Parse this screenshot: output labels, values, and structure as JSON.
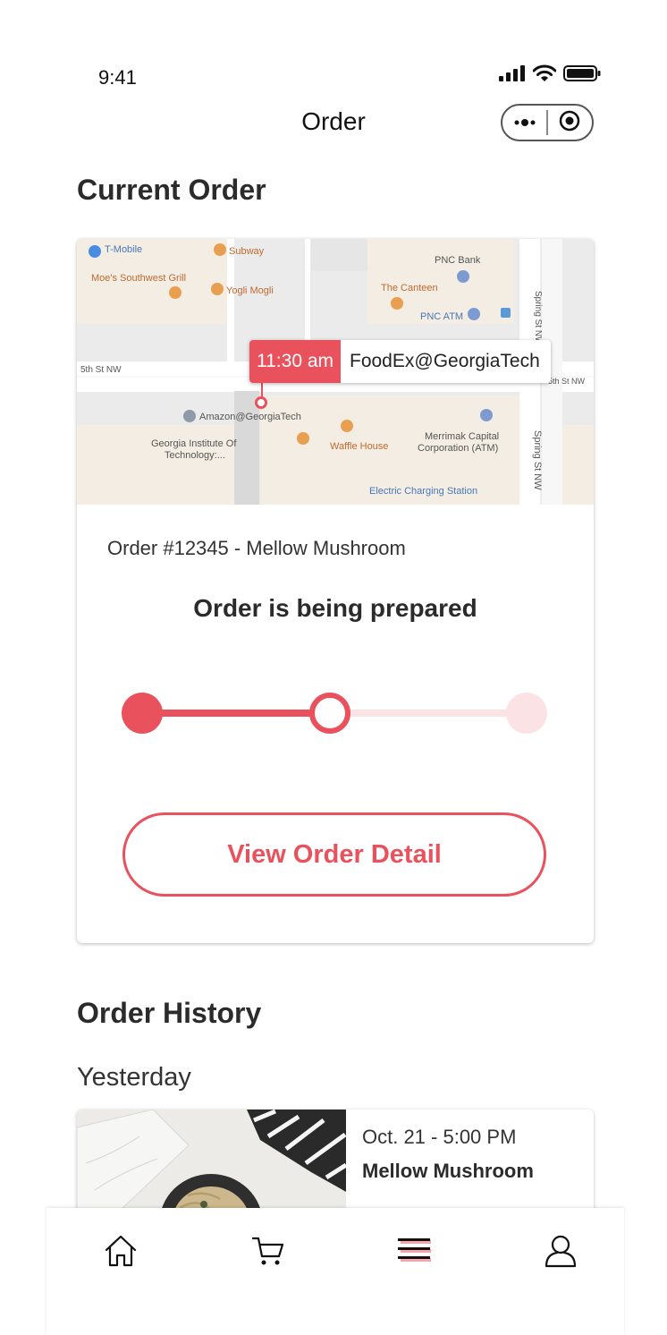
{
  "status_bar": {
    "time": "9:41"
  },
  "nav": {
    "title": "Order"
  },
  "current_order": {
    "section_title": "Current Order",
    "map": {
      "pickup_time": "11:30 am",
      "pickup_location": "FoodEx@GeorgiaTech",
      "labels": {
        "tmobile": "T-Mobile",
        "subway": "Subway",
        "moes": "Moe's Southwest Grill",
        "yogli": "Yogli Mogli",
        "pnc_bank": "PNC Bank",
        "canteen": "The Canteen",
        "pnc_atm": "PNC ATM",
        "fifth_st": "5th St NW",
        "fifth_st_right": "5th St NW",
        "amazon": "Amazon@GeorgiaTech",
        "waffle": "Waffle House",
        "merrimak_1": "Merrimak Capital",
        "merrimak_2": "Corporation (ATM)",
        "git_1": "Georgia Institute Of",
        "git_2": "Technology:...",
        "charging": "Electric Charging Station",
        "spring_st": "Spring St NW",
        "spring_st_top": "Spring St NW"
      }
    },
    "order_number": "Order #12345 - Mellow Mushroom",
    "status_text": "Order is being prepared",
    "progress_steps_completed": 2,
    "progress_steps_total": 3,
    "detail_button": "View Order Detail"
  },
  "history": {
    "section_title": "Order History",
    "groups": [
      {
        "label": "Yesterday",
        "items": [
          {
            "datetime": "Oct. 21 - 5:00 PM",
            "restaurant": "Mellow Mushroom"
          }
        ]
      }
    ]
  },
  "tabbar": {
    "items": [
      {
        "icon": "home-icon"
      },
      {
        "icon": "cart-icon"
      },
      {
        "icon": "list-icon",
        "active": true
      },
      {
        "icon": "profile-icon"
      }
    ]
  },
  "colors": {
    "accent": "#e9515c",
    "accent_light": "#fbe3e5",
    "text": "#2b2b2b"
  }
}
